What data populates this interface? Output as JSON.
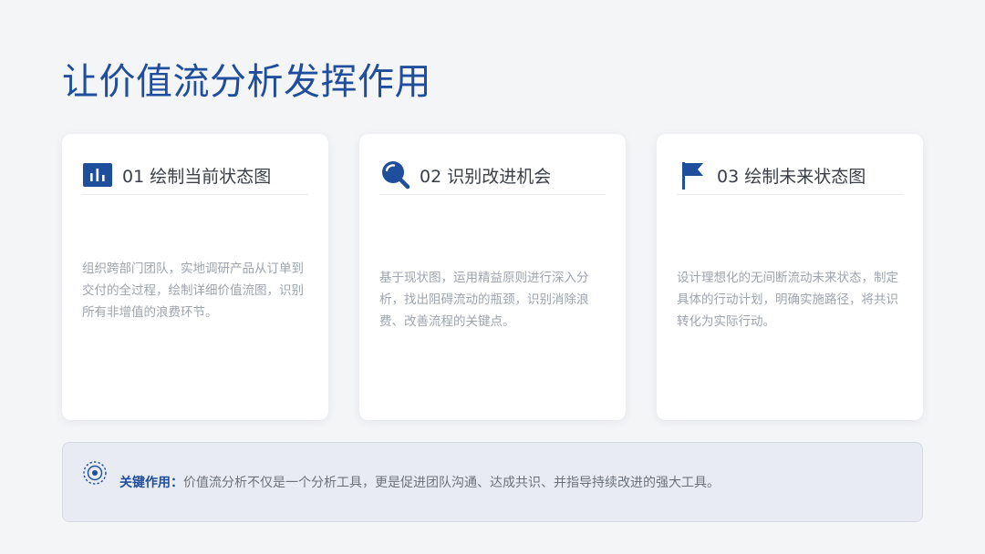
{
  "title": "让价值流分析发挥作用",
  "colors": {
    "accent": "#1f4e9c",
    "background": "#f4f5f7",
    "card": "#ffffff",
    "note_background": "#e8ecf2"
  },
  "cards": [
    {
      "icon": "bar-chart-icon",
      "title": "01 绘制当前状态图",
      "body": "组织跨部门团队，实地调研产品从订单到交付的全过程，绘制详细价值流图，识别所有非增值的浪费环节。"
    },
    {
      "icon": "magnifier-icon",
      "title": "02 识别改进机会",
      "body": "基于现状图，运用精益原则进行深入分析，找出阻碍流动的瓶颈，识别消除浪费、改善流程的关键点。"
    },
    {
      "icon": "flag-icon",
      "title": "03 绘制未来状态图",
      "body": "设计理想化的无间断流动未来状态，制定具体的行动计划，明确实施路径，将共识转化为实际行动。"
    }
  ],
  "note": {
    "icon": "target-icon",
    "label": "关键作用：",
    "text": "价值流分析不仅是一个分析工具，更是促进团队沟通、达成共识、并指导持续改进的强大工具。"
  }
}
